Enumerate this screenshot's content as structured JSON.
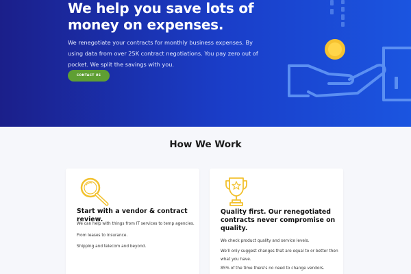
{
  "hero": {
    "title": "We help you save lots of money on expenses.",
    "body": "We renegotiate your contracts for monthly business expenses. By using data from over 25K contract negotiations. You pay zero out of pocket. We split the savings with you.",
    "cta_label": "CONTACT US",
    "illustration_icon": "hand-holding-coin-icon"
  },
  "how_we_work": {
    "title": "How We Work",
    "cards": [
      {
        "icon": "magnifying-glass-icon",
        "title": "Start with a vendor & contract review.",
        "lines": [
          "We can help with things from IT services to temp agencies.",
          "From leases to insurance.",
          "Shipping and telecom and beyond."
        ]
      },
      {
        "icon": "trophy-icon",
        "title": "Quality first. Our renegotiated contracts never compromise on quality.",
        "lines": [
          "We check product quality and service levels.",
          "We'll only suggest changes that are equal to or better then what you have.",
          "85% of the time there's no need to change vendors."
        ]
      }
    ]
  },
  "colors": {
    "hero_start": "#1b1f8a",
    "hero_end": "#1b55e0",
    "cta": "#5f9f33",
    "icon_gold": "#f2c12e",
    "art_line": "#4f86f0"
  }
}
